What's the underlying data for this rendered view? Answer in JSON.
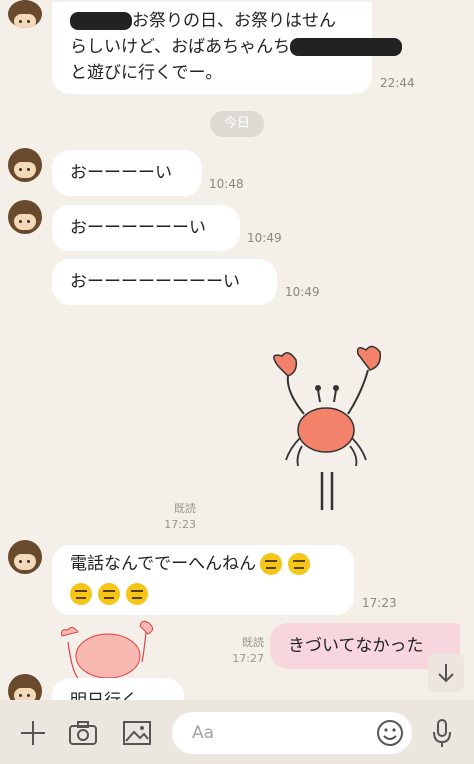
{
  "messages": {
    "m1": {
      "line1_pre": "",
      "line1_post": "お祭りの日、お祭りはせん",
      "line2_pre": "らしいけど、おばあちゃんち",
      "line3": "と遊びに行くでー。",
      "time": "22:44"
    },
    "date_divider": "今日",
    "m2": {
      "text": "おーーーーい",
      "time": "10:48"
    },
    "m3": {
      "text": "おーーーーーーい",
      "time": "10:49"
    },
    "m4": {
      "text": "おーーーーーーーーい",
      "time": "10:49"
    },
    "sticker_read": {
      "label": "既読",
      "time": "17:23"
    },
    "m5": {
      "line1": "電話なんででーへんねん",
      "time": "17:23"
    },
    "m6": {
      "read": "既読",
      "time": "17:27",
      "text": "きづいてなかった"
    },
    "m7": {
      "text": "明日行く"
    }
  },
  "toolbar": {
    "input_placeholder": "Aa"
  },
  "icons": [
    "plus-icon",
    "camera-icon",
    "image-icon",
    "emoji-icon",
    "microphone-icon",
    "arrow-down-icon"
  ],
  "colors": {
    "background": "#f4efe9",
    "my_bubble": "#f8d6de",
    "their_bubble": "#ffffff",
    "toolbar": "#ebe6e0"
  }
}
